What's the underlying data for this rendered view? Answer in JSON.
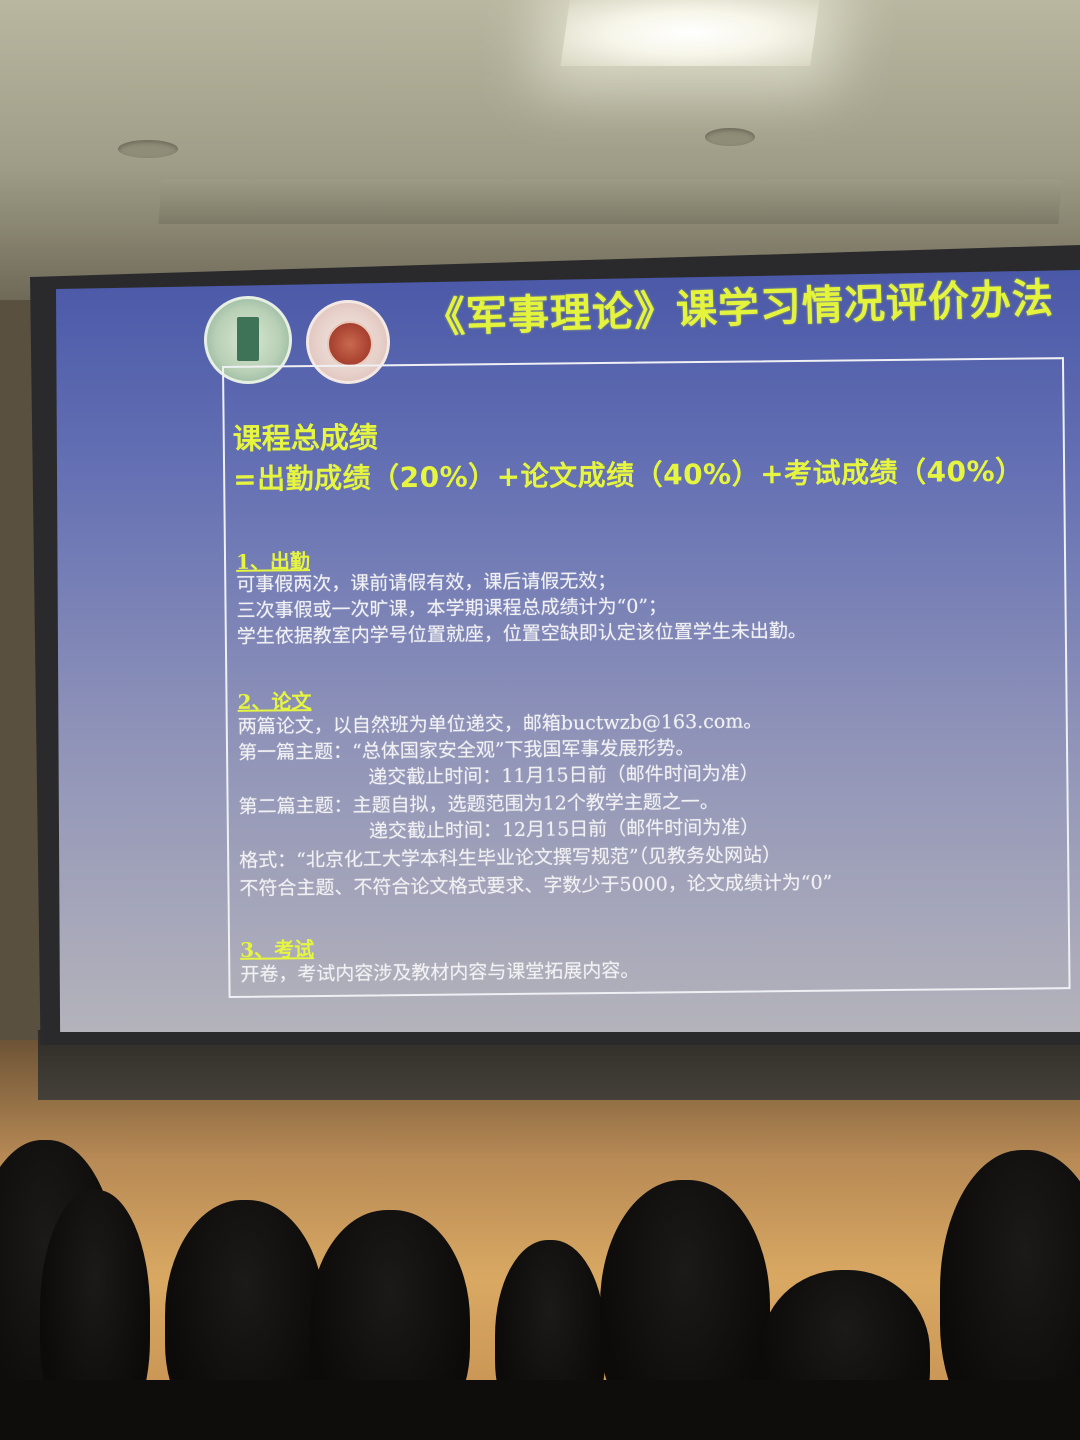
{
  "slide": {
    "title": "《军事理论》课学习情况评价办法",
    "total_grade": {
      "label": "课程总成绩",
      "formula": "=出勤成绩（20%）+论文成绩（40%）+考试成绩（40%）"
    },
    "sections": [
      {
        "heading": "1、出勤",
        "lines": [
          "可事假两次，课前请假有效，课后请假无效；",
          "三次事假或一次旷课，本学期课程总成绩计为“0”；",
          "学生依据教室内学号位置就座，位置空缺即认定该位置学生未出勤。"
        ]
      },
      {
        "heading": "2、论文",
        "lines": [
          "两篇论文，以自然班为单位递交，邮箱buctwzb@163.com。",
          "第一篇主题：“总体国家安全观”下我国军事发展形势。",
          "递交截止时间：11月15日前（邮件时间为准）",
          "第二篇主题：主题自拟，选题范围为12个教学主题之一。",
          "递交截止时间：12月15日前（邮件时间为准）",
          "格式：“北京化工大学本科生毕业论文撰写规范”（见教务处网站）",
          "不符合主题、不符合论文格式要求、字数少于5000，论文成绩计为“0”"
        ]
      },
      {
        "heading": "3、考试",
        "lines": [
          "开卷，考试内容涉及教材内容与课堂拓展内容。"
        ]
      }
    ],
    "colors": {
      "title": "#e4f43c",
      "background_top": "#4a58a8",
      "background_bottom": "#b4b3bb",
      "body_text": "#f1f1f3"
    },
    "logos": [
      "university-emblem",
      "military-seal"
    ]
  }
}
